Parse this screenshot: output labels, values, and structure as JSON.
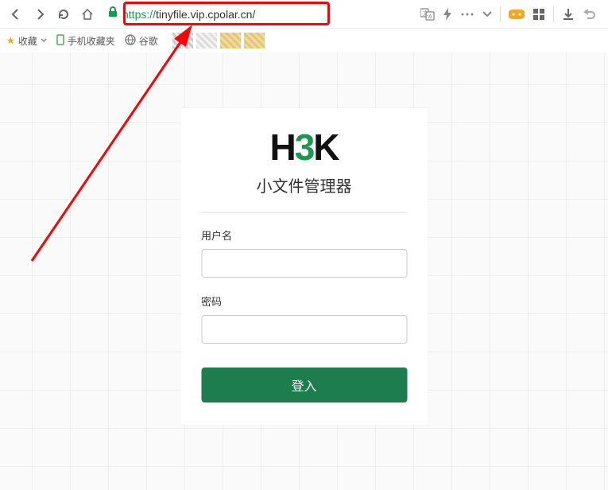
{
  "browser": {
    "url_protocol": "https://",
    "url_rest": "tinyfile.vip.cpolar.cn/"
  },
  "bookmarks": {
    "fav_label": "收藏",
    "mobile_label": "手机收藏夹",
    "google_label": "谷歌"
  },
  "login": {
    "logo_left": "H",
    "logo_mid": "3",
    "logo_right": "K",
    "title": "小文件管理器",
    "username_label": "用户名",
    "username_value": "",
    "password_label": "密码",
    "password_value": "",
    "submit_label": "登入"
  },
  "annotation": {
    "highlight_color": "#ff0000"
  }
}
